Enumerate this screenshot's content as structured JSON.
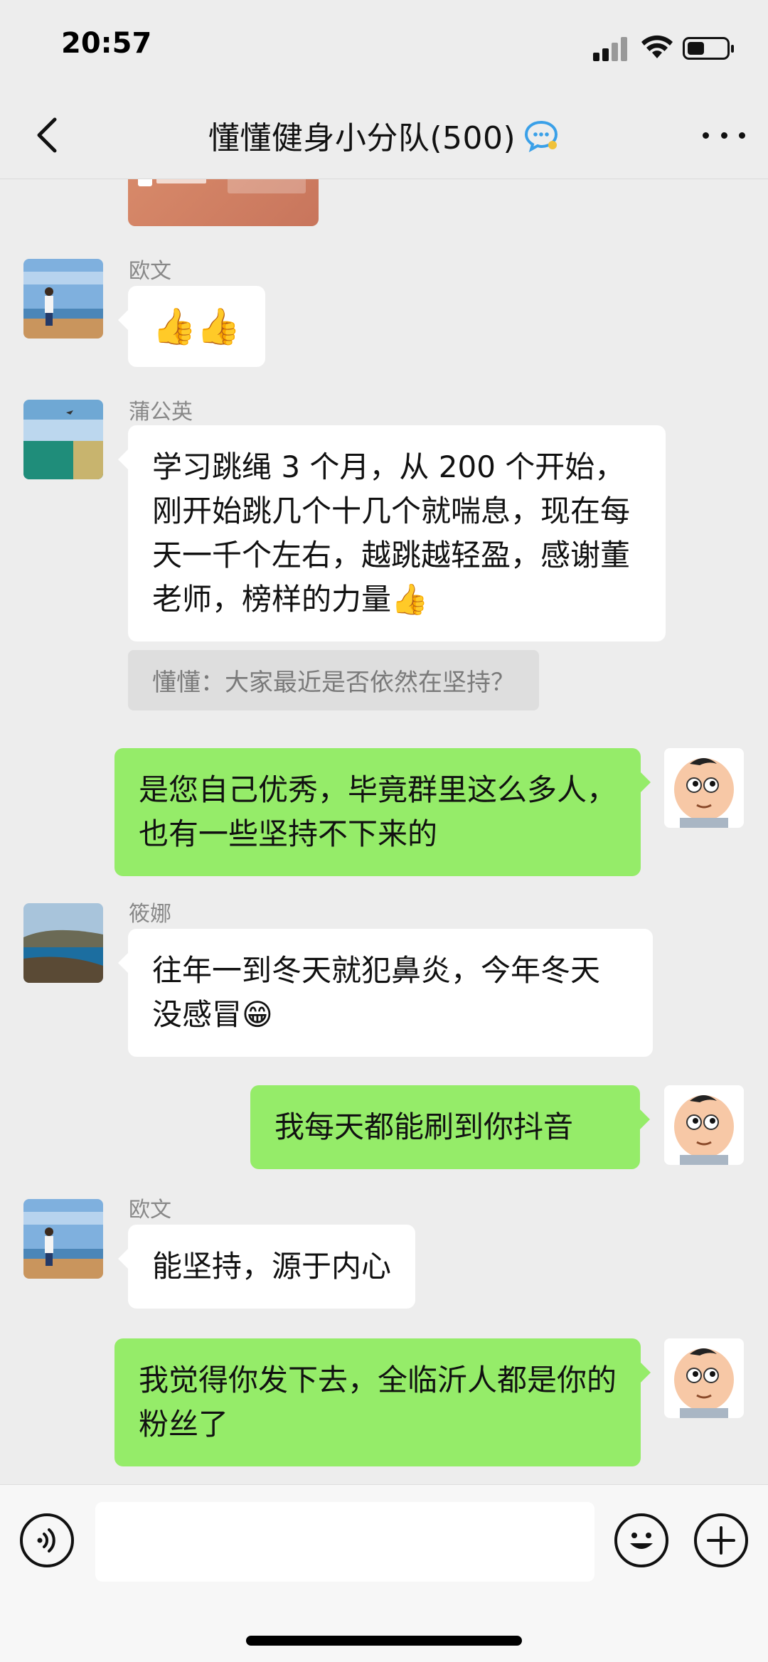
{
  "status_bar": {
    "time": "20:57",
    "battery_level": 0.45
  },
  "header": {
    "title": "懂懂健身小分队(500)"
  },
  "messages": [
    {
      "type": "in",
      "sender": "欧文",
      "text": "👍👍"
    },
    {
      "type": "in",
      "sender": "蒲公英",
      "text": "学习跳绳 3 个月，从 200 个开始，刚开始跳几个十几个就喘息，现在每天一千个左右，越跳越轻盈，感谢董老师，榜样的力量👍",
      "quote": "懂懂：大家最近是否依然在坚持？"
    },
    {
      "type": "out",
      "text": "是您自己优秀，毕竟群里这么多人，也有一些坚持不下来的"
    },
    {
      "type": "in",
      "sender": "筱娜",
      "text": "往年一到冬天就犯鼻炎，今年冬天没感冒😁"
    },
    {
      "type": "out",
      "text": "我每天都能刷到你抖音"
    },
    {
      "type": "in",
      "sender": "欧文",
      "text": "能坚持，源于内心"
    },
    {
      "type": "out",
      "text": "我觉得你发下去，全临沂人都是你的粉丝了"
    }
  ],
  "input_bar": {
    "placeholder": ""
  },
  "icons": {
    "back": "chevron-left-icon",
    "chat_badge": "chat-bubble-icon",
    "more": "more-dots-icon",
    "voice": "voice-icon",
    "emoji": "emoji-icon",
    "plus": "plus-icon"
  },
  "colors": {
    "background": "#ededed",
    "bubble_out": "#95ec69",
    "bubble_in": "#ffffff",
    "accent_blue": "#3aa0e8"
  }
}
